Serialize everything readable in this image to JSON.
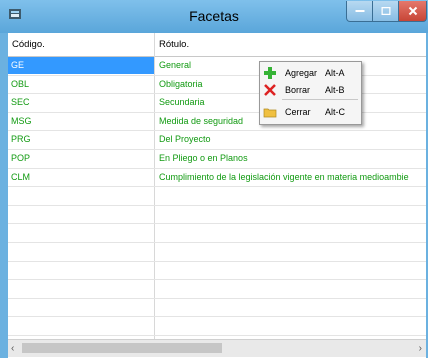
{
  "window": {
    "title": "Facetas"
  },
  "grid": {
    "columns": [
      "Código.",
      "Rótulo."
    ],
    "rows": [
      {
        "code": "GE",
        "label": "General"
      },
      {
        "code": "OBL",
        "label": "Obligatoria"
      },
      {
        "code": "SEC",
        "label": "Secundaria"
      },
      {
        "code": "MSG",
        "label": "Medida de seguridad"
      },
      {
        "code": "PRG",
        "label": "Del Proyecto"
      },
      {
        "code": "POP",
        "label": "En Pliego o en Planos"
      },
      {
        "code": "CLM",
        "label": "Cumplimiento de la legislación vigente en materia medioambie"
      }
    ],
    "selected_index": 0
  },
  "context_menu": {
    "items": [
      {
        "label": "Agregar",
        "accel": "Alt-A",
        "icon": "add-icon"
      },
      {
        "label": "Borrar",
        "accel": "Alt-B",
        "icon": "delete-icon"
      },
      {
        "label": "Cerrar",
        "accel": "Alt-C",
        "icon": "folder-icon"
      }
    ]
  },
  "colors": {
    "text_green": "#119a11",
    "selection": "#3399ff",
    "titlebar": "#6bb1e0"
  }
}
